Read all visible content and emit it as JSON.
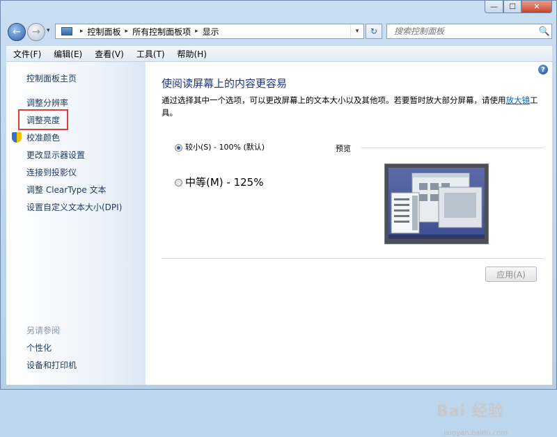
{
  "window": {
    "min_label": "—",
    "max_label": "☐",
    "close_label": "✕"
  },
  "nav": {
    "back_glyph": "←",
    "forward_glyph": "→",
    "dropdown_glyph": "▾",
    "breadcrumb": [
      "控制面板",
      "所有控制面板项",
      "显示"
    ],
    "breadcrumb_sep": "▸",
    "address_dropdown_glyph": "▾",
    "refresh_glyph": "↻",
    "search_placeholder": "搜索控制面板",
    "search_icon_glyph": "🔍"
  },
  "menubar": {
    "items": [
      "文件(F)",
      "编辑(E)",
      "查看(V)",
      "工具(T)",
      "帮助(H)"
    ]
  },
  "sidebar": {
    "home": "控制面板主页",
    "items": [
      "调整分辨率",
      "调整亮度",
      "校准颜色",
      "更改显示器设置",
      "连接到投影仪",
      "调整 ClearType 文本",
      "设置自定义文本大小(DPI)"
    ],
    "see_also_label": "另请参阅",
    "see_also": [
      "个性化",
      "设备和打印机"
    ]
  },
  "main": {
    "help_glyph": "?",
    "title": "使阅读屏幕上的内容更容易",
    "description_prefix": "通过选择其中一个选项，可以更改屏幕上的文本大小以及其他项。若要暂时放大部分屏幕，请使用",
    "description_link": "放大镜",
    "description_suffix": "工具。",
    "options": [
      {
        "label": "较小(S) - 100% (默认)",
        "selected": true
      },
      {
        "label": "中等(M) - 125%",
        "selected": false
      }
    ],
    "preview_label": "预览",
    "apply_label": "应用(A)"
  },
  "watermark": {
    "line1": "Bai 经验",
    "line2": "jingyan.baidu.com"
  },
  "colors": {
    "title_blue": "#1e3287",
    "link_blue": "#0066cc",
    "sidebar_text": "#1e395b",
    "highlight_red": "#e23b3b"
  }
}
